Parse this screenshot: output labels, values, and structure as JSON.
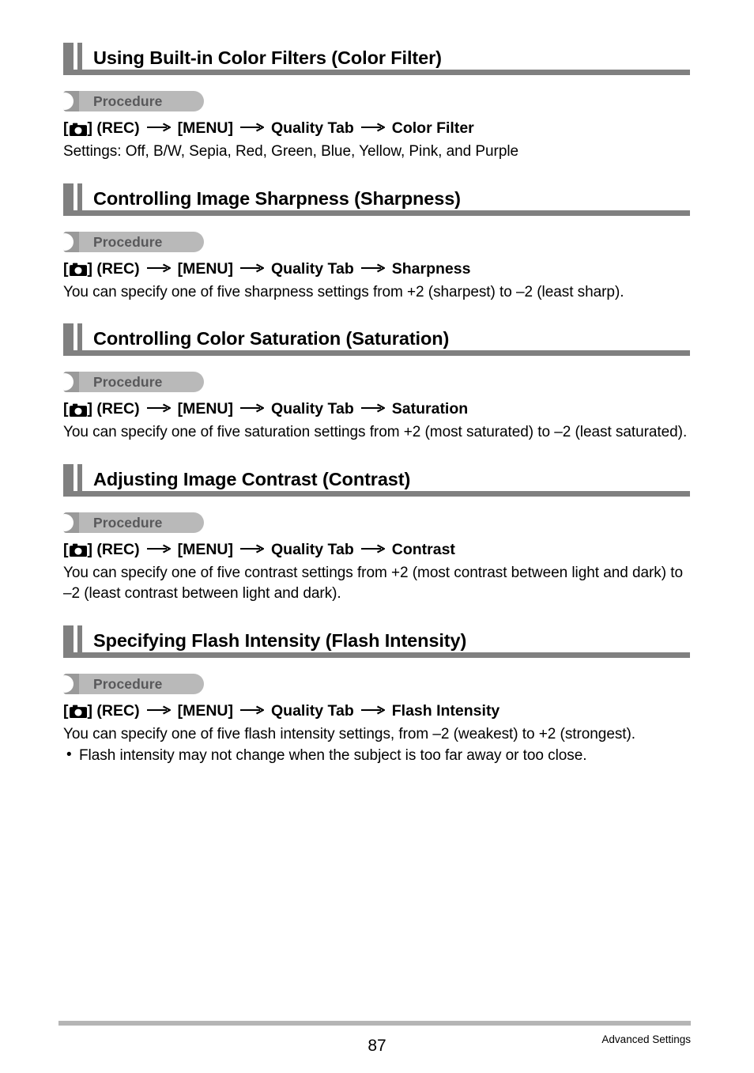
{
  "document": {
    "page_number": "87",
    "footer_section_label": "Advanced Settings"
  },
  "icons": {
    "camera": "camera-icon",
    "arrow": "arrow-right-icon",
    "bullet": "•"
  },
  "colors": {
    "section_bar": "#808080",
    "heading_rule": "#808080",
    "procedure_pill": "#b9b9b9",
    "procedure_cap": "#9a9a9a",
    "procedure_text": "#58585a",
    "footer_rule": "#b5b5b5",
    "text": "#000000"
  },
  "procedure_label": "Procedure",
  "sections": [
    {
      "title": "Using Built-in Color Filters (Color Filter)",
      "procedure_label": "Procedure",
      "path": {
        "prefix_open": "[",
        "prefix_close": "]",
        "rec_label": "(REC)",
        "menu_label": "[MENU]",
        "tab_label": "Quality Tab",
        "item_label": "Color Filter"
      },
      "body": "Settings: Off, B/W, Sepia, Red, Green, Blue, Yellow, Pink, and Purple",
      "notes": []
    },
    {
      "title": "Controlling Image Sharpness (Sharpness)",
      "procedure_label": "Procedure",
      "path": {
        "prefix_open": "[",
        "prefix_close": "]",
        "rec_label": "(REC)",
        "menu_label": "[MENU]",
        "tab_label": "Quality Tab",
        "item_label": "Sharpness"
      },
      "body": "You can specify one of five sharpness settings from +2 (sharpest) to –2 (least sharp).",
      "notes": []
    },
    {
      "title": "Controlling Color Saturation (Saturation)",
      "procedure_label": "Procedure",
      "path": {
        "prefix_open": "[",
        "prefix_close": "]",
        "rec_label": "(REC)",
        "menu_label": "[MENU]",
        "tab_label": "Quality Tab",
        "item_label": "Saturation"
      },
      "body": "You can specify one of five saturation settings from +2 (most saturated) to –2 (least saturated).",
      "notes": []
    },
    {
      "title": "Adjusting Image Contrast (Contrast)",
      "procedure_label": "Procedure",
      "path": {
        "prefix_open": "[",
        "prefix_close": "]",
        "rec_label": "(REC)",
        "menu_label": "[MENU]",
        "tab_label": "Quality Tab",
        "item_label": "Contrast"
      },
      "body": "You can specify one of five contrast settings from +2 (most contrast between light and dark) to –2 (least contrast between light and dark).",
      "notes": []
    },
    {
      "title": "Specifying Flash Intensity (Flash Intensity)",
      "procedure_label": "Procedure",
      "path": {
        "prefix_open": "[",
        "prefix_close": "]",
        "rec_label": "(REC)",
        "menu_label": "[MENU]",
        "tab_label": "Quality Tab",
        "item_label": "Flash Intensity"
      },
      "body": "You can specify one of five flash intensity settings, from –2 (weakest) to +2 (strongest).",
      "notes": [
        "Flash intensity may not change when the subject is too far away or too close."
      ]
    }
  ]
}
